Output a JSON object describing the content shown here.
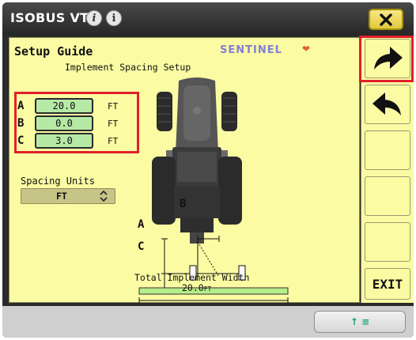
{
  "titlebar": {
    "title": "ISOBUS VT",
    "icons": [
      "info-icon",
      "info-alt-icon"
    ],
    "close_icon": "close-icon"
  },
  "setup": {
    "heading": "Setup Guide",
    "brand": "SENTINEL",
    "subheading": "Implement Spacing Setup",
    "fields": [
      {
        "letter": "A",
        "value": "20.0",
        "unit": "FT"
      },
      {
        "letter": "B",
        "value": "0.0",
        "unit": "FT"
      },
      {
        "letter": "C",
        "value": "3.0",
        "unit": "FT"
      }
    ],
    "spacing_units_label": "Spacing Units",
    "spacing_units_value": "FT",
    "diagram": {
      "label_a": "A",
      "label_b": "B",
      "label_c": "C",
      "width_caption": "Total Implement Width",
      "width_value": "20.0",
      "width_unit": "FT"
    }
  },
  "softkeys": {
    "forward_icon": "arrow-forward-icon",
    "back_icon": "arrow-back-icon",
    "exit_label": "EXIT"
  },
  "bottombar": {
    "nav_icon": "navigation-icon",
    "nav_label": "↑ ≡"
  },
  "colors": {
    "workspace_bg": "#fbfba3",
    "field_bg": "#b6e8a6",
    "highlight": "#e0202a",
    "close_button": "#e2c93a"
  }
}
